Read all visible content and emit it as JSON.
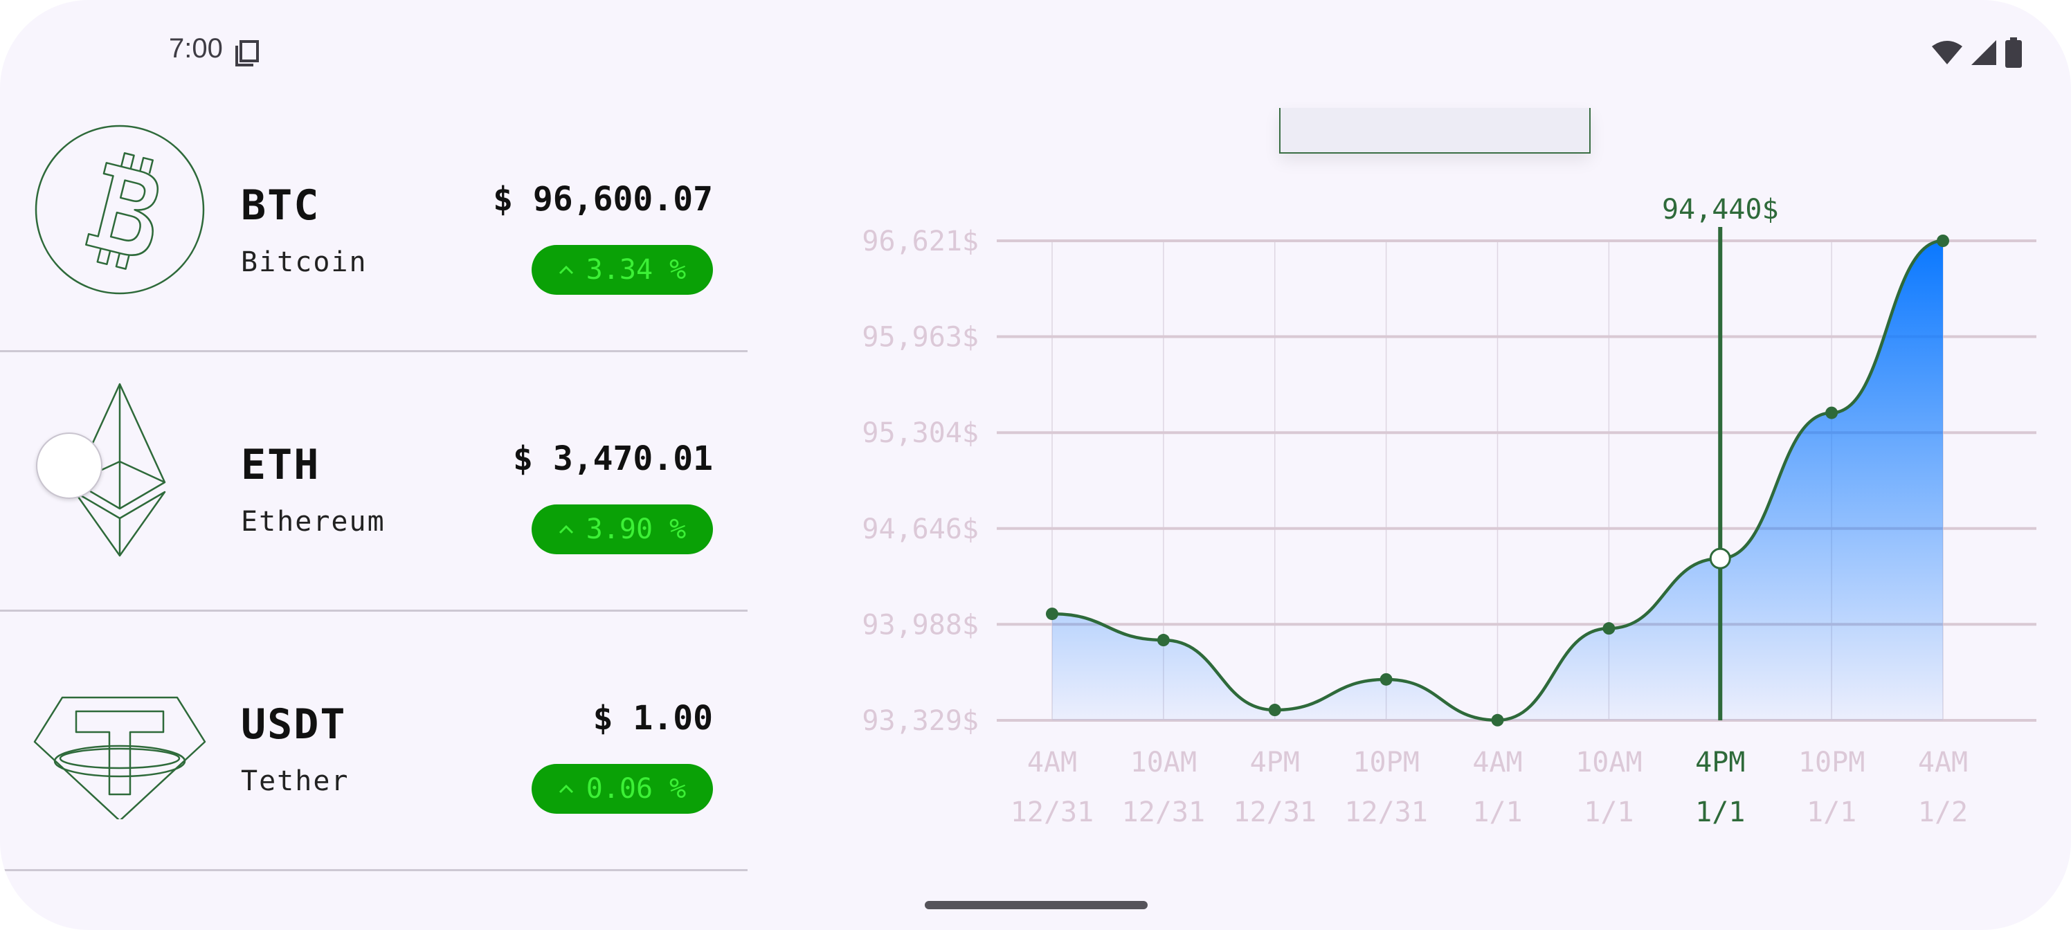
{
  "status_bar": {
    "time": "7:00",
    "icons": [
      "clipboard-icon",
      "wifi-icon",
      "signal-icon",
      "battery-icon"
    ]
  },
  "coins": [
    {
      "ticker": "BTC",
      "name": "Bitcoin",
      "price": "$ 96,600.07",
      "change": "3.34 %",
      "icon": "bitcoin-icon"
    },
    {
      "ticker": "ETH",
      "name": "Ethereum",
      "price": "$ 3,470.01",
      "change": "3.90 %",
      "icon": "ethereum-icon"
    },
    {
      "ticker": "USDT",
      "name": "Tether",
      "price": "$ 1.00",
      "change": "0.06 %",
      "icon": "tether-icon"
    }
  ],
  "colors": {
    "accent_green": "#2e6a3a",
    "change_bg": "#0aa106",
    "change_text": "#3cf036",
    "fill_top": "#0a78ff",
    "axis_label": "#dcc9d8",
    "grid": "#d9c9d4"
  },
  "chart_data": {
    "type": "area",
    "y_tick_labels": [
      "96,621$",
      "95,963$",
      "95,304$",
      "94,646$",
      "93,988$",
      "93,329$"
    ],
    "y_ticks": [
      96621,
      95963,
      95304,
      94646,
      93988,
      93329
    ],
    "ylim": [
      93329,
      96621
    ],
    "x_categories": [
      {
        "time": "4AM",
        "date": "12/31"
      },
      {
        "time": "10AM",
        "date": "12/31"
      },
      {
        "time": "4PM",
        "date": "12/31"
      },
      {
        "time": "10PM",
        "date": "12/31"
      },
      {
        "time": "4AM",
        "date": "1/1"
      },
      {
        "time": "10AM",
        "date": "1/1"
      },
      {
        "time": "4PM",
        "date": "1/1"
      },
      {
        "time": "10PM",
        "date": "1/1"
      },
      {
        "time": "4AM",
        "date": "1/2"
      }
    ],
    "values": [
      94060,
      93880,
      93400,
      93610,
      93330,
      93960,
      94440,
      95440,
      96621
    ],
    "selected_index": 6,
    "selected_label": "94,440$",
    "grid": true
  }
}
